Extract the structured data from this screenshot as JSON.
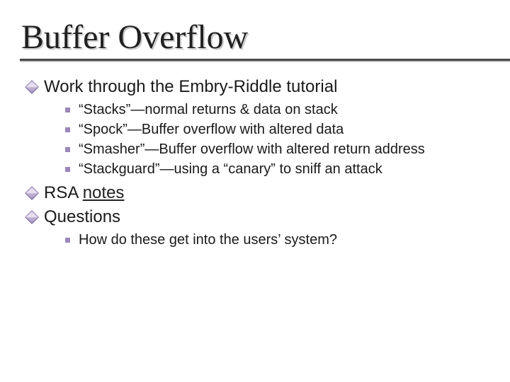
{
  "title": "Buffer Overflow",
  "items": [
    {
      "text": "Work through the Embry-Riddle tutorial",
      "sub": [
        "“Stacks”—normal returns & data on stack",
        "“Spock”—Buffer overflow with altered data",
        "“Smasher”—Buffer overflow with altered return address",
        "“Stackguard”—using a “canary” to sniff an attack"
      ]
    },
    {
      "text_prefix": "RSA ",
      "link": "notes",
      "sub": []
    },
    {
      "text": "Questions",
      "sub": [
        "How do these get into the users’ system?"
      ]
    }
  ]
}
